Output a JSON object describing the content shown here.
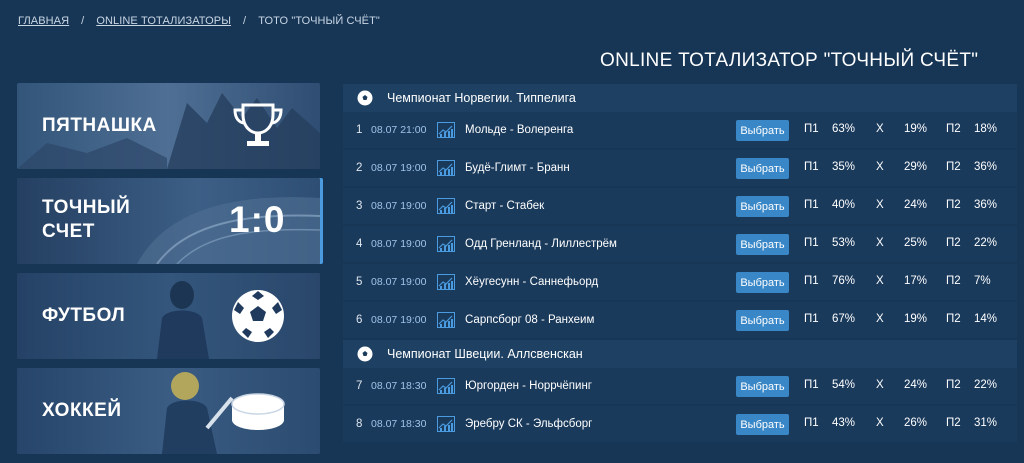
{
  "breadcrumb": {
    "home": "ГЛАВНАЯ",
    "section": "ONLINE ТОТАЛИЗАТОРЫ",
    "current": "ТОТО \"ТОЧНЫЙ СЧЁТ\"",
    "separator": "/"
  },
  "page_title": "ONLINE ТОТАЛИЗАТОР \"ТОЧНЫЙ СЧЁТ\"",
  "sidebar": {
    "items": [
      {
        "label": "ПЯТНАШКА",
        "icon": "trophy-icon"
      },
      {
        "label_line1": "ТОЧНЫЙ",
        "label_line2": "СЧЕТ",
        "score": "1:0",
        "active": true
      },
      {
        "label": "ФУТБОЛ",
        "icon": "soccer-ball-icon"
      },
      {
        "label": "ХОККЕЙ",
        "icon": "hockey-puck-icon"
      }
    ]
  },
  "leagues": [
    {
      "name": "Чемпионат Норвегии. Типпелига",
      "matches": [
        {
          "num": "1",
          "date": "08.07 21:00",
          "teams": "Мольде - Волеренга",
          "p1": "63%",
          "x": "19%",
          "p2": "18%"
        },
        {
          "num": "2",
          "date": "08.07 19:00",
          "teams": "Будё-Глимт - Бранн",
          "p1": "35%",
          "x": "29%",
          "p2": "36%"
        },
        {
          "num": "3",
          "date": "08.07 19:00",
          "teams": "Старт - Стабек",
          "p1": "40%",
          "x": "24%",
          "p2": "36%"
        },
        {
          "num": "4",
          "date": "08.07 19:00",
          "teams": "Одд Гренланд - Лиллестрём",
          "p1": "53%",
          "x": "25%",
          "p2": "22%"
        },
        {
          "num": "5",
          "date": "08.07 19:00",
          "teams": "Хёугесунн - Саннефьорд",
          "p1": "76%",
          "x": "17%",
          "p2": "7%"
        },
        {
          "num": "6",
          "date": "08.07 19:00",
          "teams": "Сарпсборг 08 - Ранхеим",
          "p1": "67%",
          "x": "19%",
          "p2": "14%"
        }
      ]
    },
    {
      "name": "Чемпионат Швеции. Аллсвенскан",
      "matches": [
        {
          "num": "7",
          "date": "08.07 18:30",
          "teams": "Юргорден - Норрчёпинг",
          "p1": "54%",
          "x": "24%",
          "p2": "22%"
        },
        {
          "num": "8",
          "date": "08.07 18:30",
          "teams": "Эребру СК - Эльфсборг",
          "p1": "43%",
          "x": "26%",
          "p2": "31%"
        }
      ]
    }
  ],
  "labels": {
    "choose": "Выбрать",
    "p1": "П1",
    "x": "Х",
    "p2": "П2"
  },
  "colors": {
    "background": "#173656",
    "row": "#1a3a5c",
    "league_header": "#1e4163",
    "button": "#3a87c7",
    "date": "#9fc4e8",
    "active_indicator": "#4a9be0"
  }
}
